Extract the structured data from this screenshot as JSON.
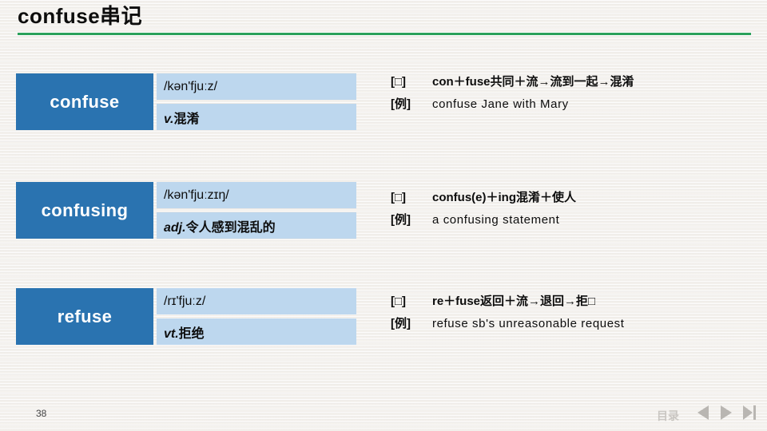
{
  "slide": {
    "title": "confuse串记",
    "accent_line_color": "#2aa05a",
    "word_box_color": "#2a73b0",
    "meta_box_color": "#bdd7ee",
    "background_color": "#f2f0ed"
  },
  "entries": [
    {
      "word": "confuse",
      "phonetic": "/kən'fjuːz/",
      "pos": "v.",
      "meaning": "混淆",
      "notes": [
        {
          "tag": "[□]",
          "text": "con＋fuse共同＋流→流到一起→混淆",
          "style": "bold"
        },
        {
          "tag": "[例]",
          "text": "confuse Jane with Mary",
          "style": "plain"
        }
      ]
    },
    {
      "word": "confusing",
      "phonetic": "/kən'fjuːzɪŋ/",
      "pos": "adj.",
      "meaning": "令人感到混乱的",
      "notes": [
        {
          "tag": "[□]",
          "text": "confus(e)＋ing混淆＋使人",
          "style": "bold"
        },
        {
          "tag": "[例]",
          "text": "a confusing statement",
          "style": "plain"
        }
      ]
    },
    {
      "word": "refuse",
      "phonetic": "/rɪ'fjuːz/",
      "pos": "vt.",
      "meaning": "拒绝",
      "notes": [
        {
          "tag": "[□]",
          "text": "re＋fuse返回＋流→退回→拒□",
          "style": "bold"
        },
        {
          "tag": "[例]",
          "text": "refuse sb's unreasonable request",
          "style": "plain"
        }
      ]
    }
  ],
  "footer": {
    "page_number": "38",
    "toc_label": "目录",
    "nav": [
      {
        "name": "previous-slide-button",
        "icon": "triangle-left-icon"
      },
      {
        "name": "next-slide-button",
        "icon": "triangle-right-icon"
      },
      {
        "name": "last-slide-button",
        "icon": "triangle-right-bar-icon"
      }
    ]
  }
}
